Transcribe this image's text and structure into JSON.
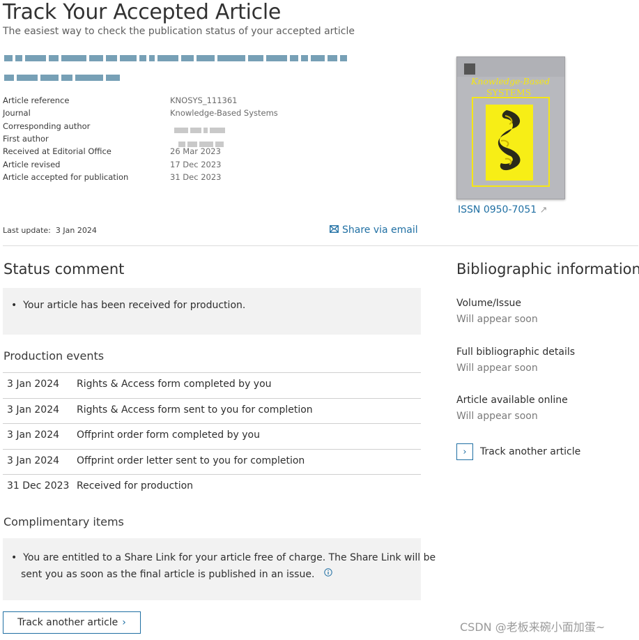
{
  "header": {
    "title": "Track Your Accepted Article",
    "subtitle": "The easiest way to check the publication status of your accepted article"
  },
  "article": {
    "rows": [
      {
        "label": "Article reference",
        "value": "KNOSYS_111361"
      },
      {
        "label": "Journal",
        "value": "Knowledge-Based Systems"
      },
      {
        "label": "Corresponding author",
        "value": ""
      },
      {
        "label": "First author",
        "value": ""
      },
      {
        "label": "Received at Editorial Office",
        "value": "26 Mar 2023"
      },
      {
        "label": "Article revised",
        "value": "17 Dec 2023"
      },
      {
        "label": "Article accepted for publication",
        "value": "31 Dec 2023"
      }
    ],
    "last_update_label": "Last update:",
    "last_update_value": "3 Jan 2024",
    "share_label": "Share via email"
  },
  "cover": {
    "title_line1": "Knowledge-Based",
    "title_line2": "SYSTEMS",
    "issn": "ISSN 0950-7051"
  },
  "status": {
    "heading": "Status comment",
    "comment": "Your article has been received for production."
  },
  "production": {
    "heading": "Production events",
    "events": [
      {
        "date": "3 Jan 2024",
        "desc": "Rights & Access form completed by you"
      },
      {
        "date": "3 Jan 2024",
        "desc": "Rights & Access form sent to you for completion"
      },
      {
        "date": "3 Jan 2024",
        "desc": "Offprint order form completed by you"
      },
      {
        "date": "3 Jan 2024",
        "desc": "Offprint order letter sent to you for completion"
      },
      {
        "date": "31 Dec 2023",
        "desc": "Received for production"
      }
    ]
  },
  "complimentary": {
    "heading": "Complimentary items",
    "text_line1": "You are entitled to a Share Link for your article free of charge. The Share Link will be",
    "text_line2": "sent you as soon as the final article is published in an issue."
  },
  "track_button_label": "Track another article",
  "bibliographic": {
    "heading": "Bibliographic information",
    "items": [
      {
        "label": "Volume/Issue",
        "value": "Will appear soon"
      },
      {
        "label": "Full bibliographic details",
        "value": "Will appear soon"
      },
      {
        "label": "Article available online",
        "value": "Will appear soon"
      }
    ],
    "track_label": "Track another article"
  },
  "watermark": "CSDN @老板来碗小面加蛋~",
  "colors": {
    "link": "#1f6fa3",
    "panel": "#f2f2f2",
    "cover_yellow": "#f7ee16"
  }
}
